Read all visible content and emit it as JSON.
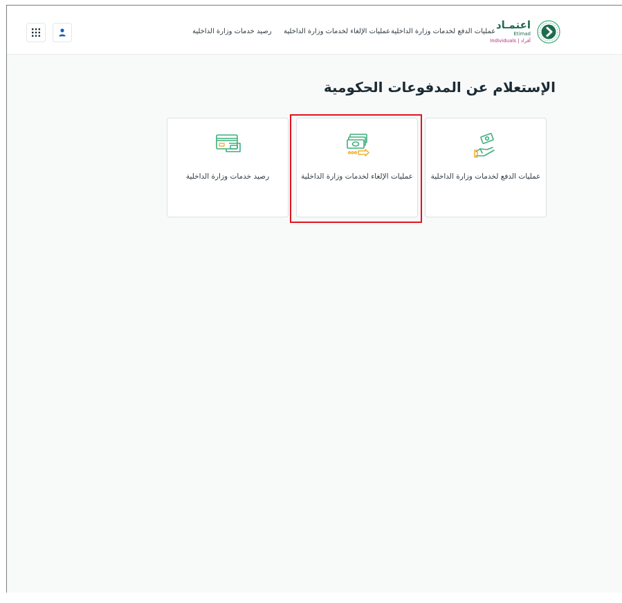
{
  "header": {
    "logo": {
      "name": "اعتمـاد",
      "sub": "Etimad",
      "individuals": "Individuals | أفراد"
    },
    "nav": [
      {
        "label": "عمليات الدفع لخدمات وزارة الداخلية"
      },
      {
        "label": "عمليات الإلغاء لخدمات وزارة الداخلية"
      },
      {
        "label": "رصيد خدمات وزارة الداخلية"
      }
    ],
    "icons": [
      "apps-grid-icon",
      "user-icon"
    ]
  },
  "main": {
    "title": "الإستعلام عن المدفوعات الحكومية",
    "cards": [
      {
        "label": "عمليات الدفع لخدمات وزارة الداخلية",
        "icon": "hand-money-icon"
      },
      {
        "label": "عمليات الإلغاء لخدمات وزارة الداخلية",
        "icon": "money-refund-icon"
      },
      {
        "label": "رصيد خدمات وزارة الداخلية",
        "icon": "card-balance-icon"
      }
    ]
  },
  "colors": {
    "brand_green": "#1f6b4e",
    "icon_green": "#3fae7c",
    "icon_amber": "#f2b233",
    "highlight": "#e0141e"
  }
}
